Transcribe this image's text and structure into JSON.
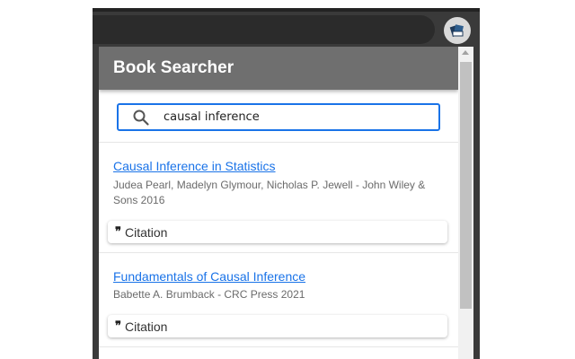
{
  "app": {
    "title": "Book Searcher"
  },
  "search": {
    "value": "causal inference",
    "icon": "search-icon"
  },
  "results": [
    {
      "title": "Causal Inference in Statistics",
      "meta": "Judea Pearl, Madelyn Glymour, Nicholas P. Jewell - John Wiley & Sons 2016",
      "citation_label": "Citation"
    },
    {
      "title": "Fundamentals of Causal Inference",
      "meta": "Babette A. Brumback - CRC Press 2021",
      "citation_label": "Citation"
    }
  ],
  "colors": {
    "header_bg": "#6f6f6f",
    "accent": "#1a73e8",
    "browser_bar": "#3a3a3a"
  }
}
